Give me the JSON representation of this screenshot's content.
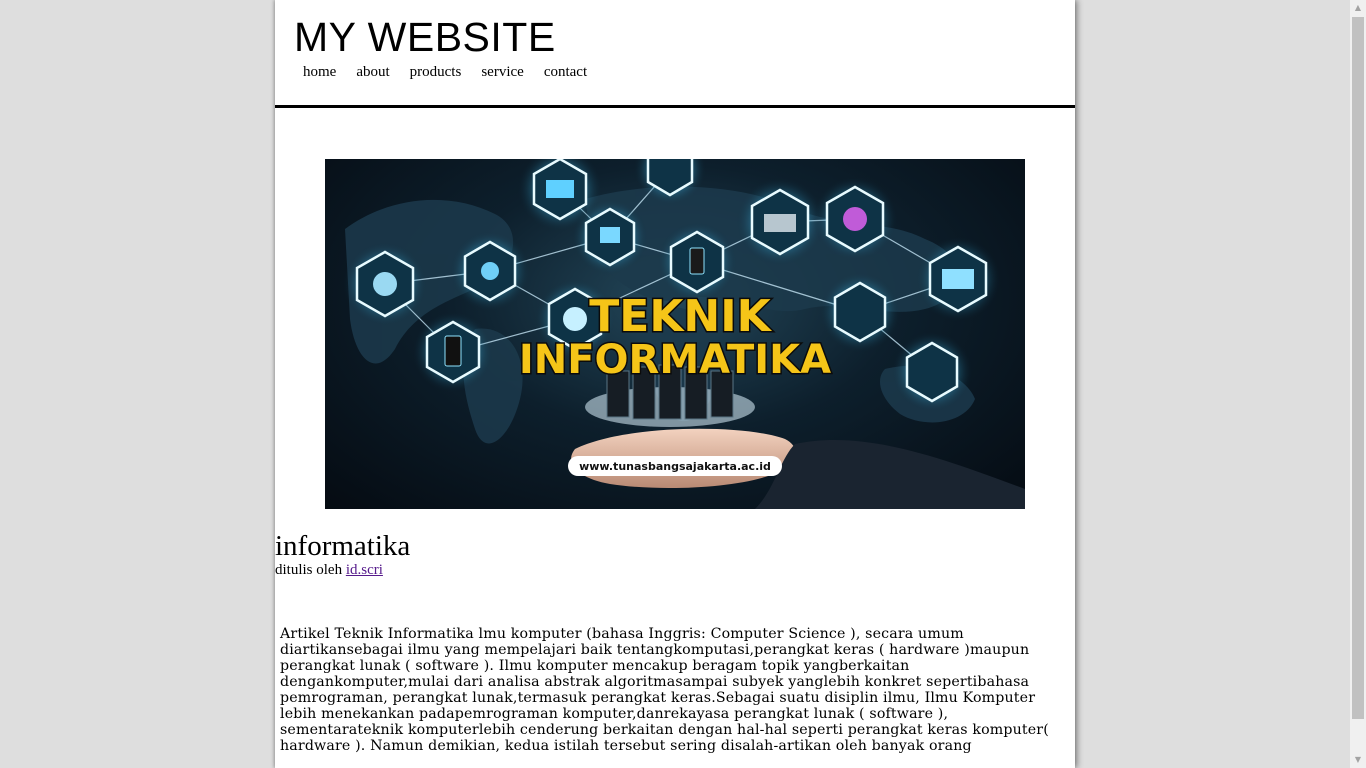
{
  "site": {
    "title": "MY WEBSITE",
    "nav": [
      "home",
      "about",
      "products",
      "service",
      "contact"
    ]
  },
  "banner": {
    "headline_line1": "TEKNIK",
    "headline_line2": "INFORMATIKA",
    "url_pill": "www.tunasbangsajakarta.ac.id"
  },
  "post": {
    "title": "informatika",
    "byline_prefix": "ditulis oleh",
    "author": "id.scri",
    "body": "Artikel Teknik Informatika lmu komputer (bahasa Inggris: Computer Science ), secara umum diartikansebagai ilmu yang mempelajari baik tentangkomputasi,perangkat keras ( hardware )maupun perangkat lunak ( software ). Ilmu komputer mencakup beragam topik yangberkaitan dengankomputer,mulai dari analisa abstrak algoritmasampai subyek yanglebih konkret sepertibahasa pemrograman, perangkat lunak,termasuk perangkat keras.Sebagai suatu disiplin ilmu, Ilmu Komputer lebih menekankan padapemrograman komputer,danrekayasa perangkat lunak ( software ), sementarateknik komputerlebih cenderung berkaitan dengan hal-hal seperti perangkat keras komputer( hardware ). Namun demikian, kedua istilah tersebut sering disalah-artikan oleh banyak orang"
  },
  "colors": {
    "background": "#dedede",
    "headline_fill": "#f5c518",
    "visited_link": "#551a8b"
  }
}
